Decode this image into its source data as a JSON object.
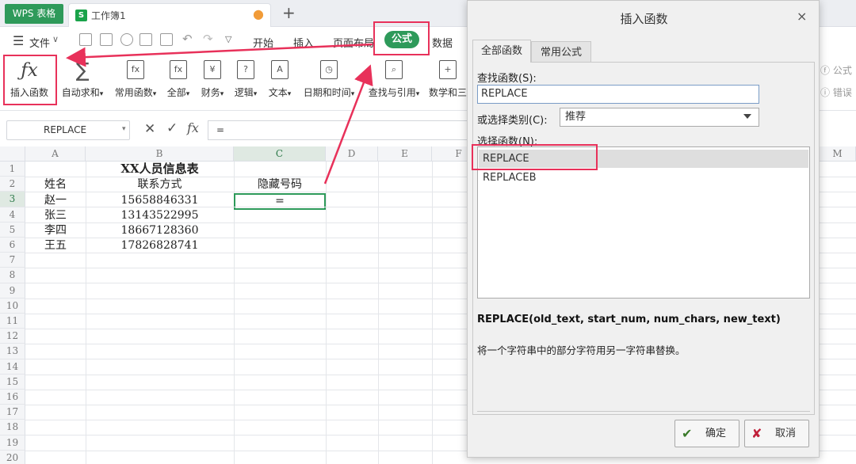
{
  "tabbar": {
    "wps_label": "WPS 表格",
    "doc_icon": "S",
    "doc_name": "工作簿1",
    "new_tab": "+"
  },
  "menu": {
    "file_label": "文件",
    "tabs": [
      "开始",
      "插入",
      "页面布局",
      "公式",
      "数据"
    ]
  },
  "ribbon": {
    "insert_fn": "插入函数",
    "autosum": "自动求和",
    "common": "常用函数",
    "all": "全部",
    "finance": "财务",
    "logic": "逻辑",
    "text": "文本",
    "datetime": "日期和时间",
    "lookup": "查找与引用",
    "math": "数学和三",
    "right1": "公式",
    "right2": "错误"
  },
  "formula_bar": {
    "namebox": "REPLACE",
    "fx": "fx",
    "value": "="
  },
  "columns": [
    "A",
    "B",
    "C",
    "D",
    "E",
    "F",
    "M"
  ],
  "rows": [
    "1",
    "2",
    "3",
    "4",
    "5",
    "6",
    "7",
    "8",
    "9",
    "10",
    "11",
    "12",
    "13",
    "14",
    "15",
    "16",
    "17",
    "18",
    "19",
    "20"
  ],
  "sheet": {
    "title": "XX人员信息表",
    "headers": {
      "name": "姓名",
      "phone": "联系方式",
      "hidden": "隐藏号码"
    },
    "data": [
      {
        "name": "赵一",
        "phone": "15658846331"
      },
      {
        "name": "张三",
        "phone": "13143522995"
      },
      {
        "name": "李四",
        "phone": "18667128360"
      },
      {
        "name": "王五",
        "phone": "17826828741"
      }
    ],
    "active_value": "="
  },
  "dialog": {
    "title": "插入函数",
    "close": "×",
    "tab_all": "全部函数",
    "tab_common": "常用公式",
    "search_label": "查找函数(S):",
    "search_value": "REPLACE",
    "category_label": "或选择类别(C):",
    "category_value": "推荐",
    "select_label": "选择函数(N):",
    "functions": [
      "REPLACE",
      "REPLACEB"
    ],
    "signature": "REPLACE(old_text, start_num, num_chars, new_text)",
    "description": "将一个字符串中的部分字符用另一字符串替换。",
    "ok": "确定",
    "cancel": "取消"
  },
  "colors": {
    "accent": "#2e9a5a",
    "annotation": "#e8315a"
  }
}
